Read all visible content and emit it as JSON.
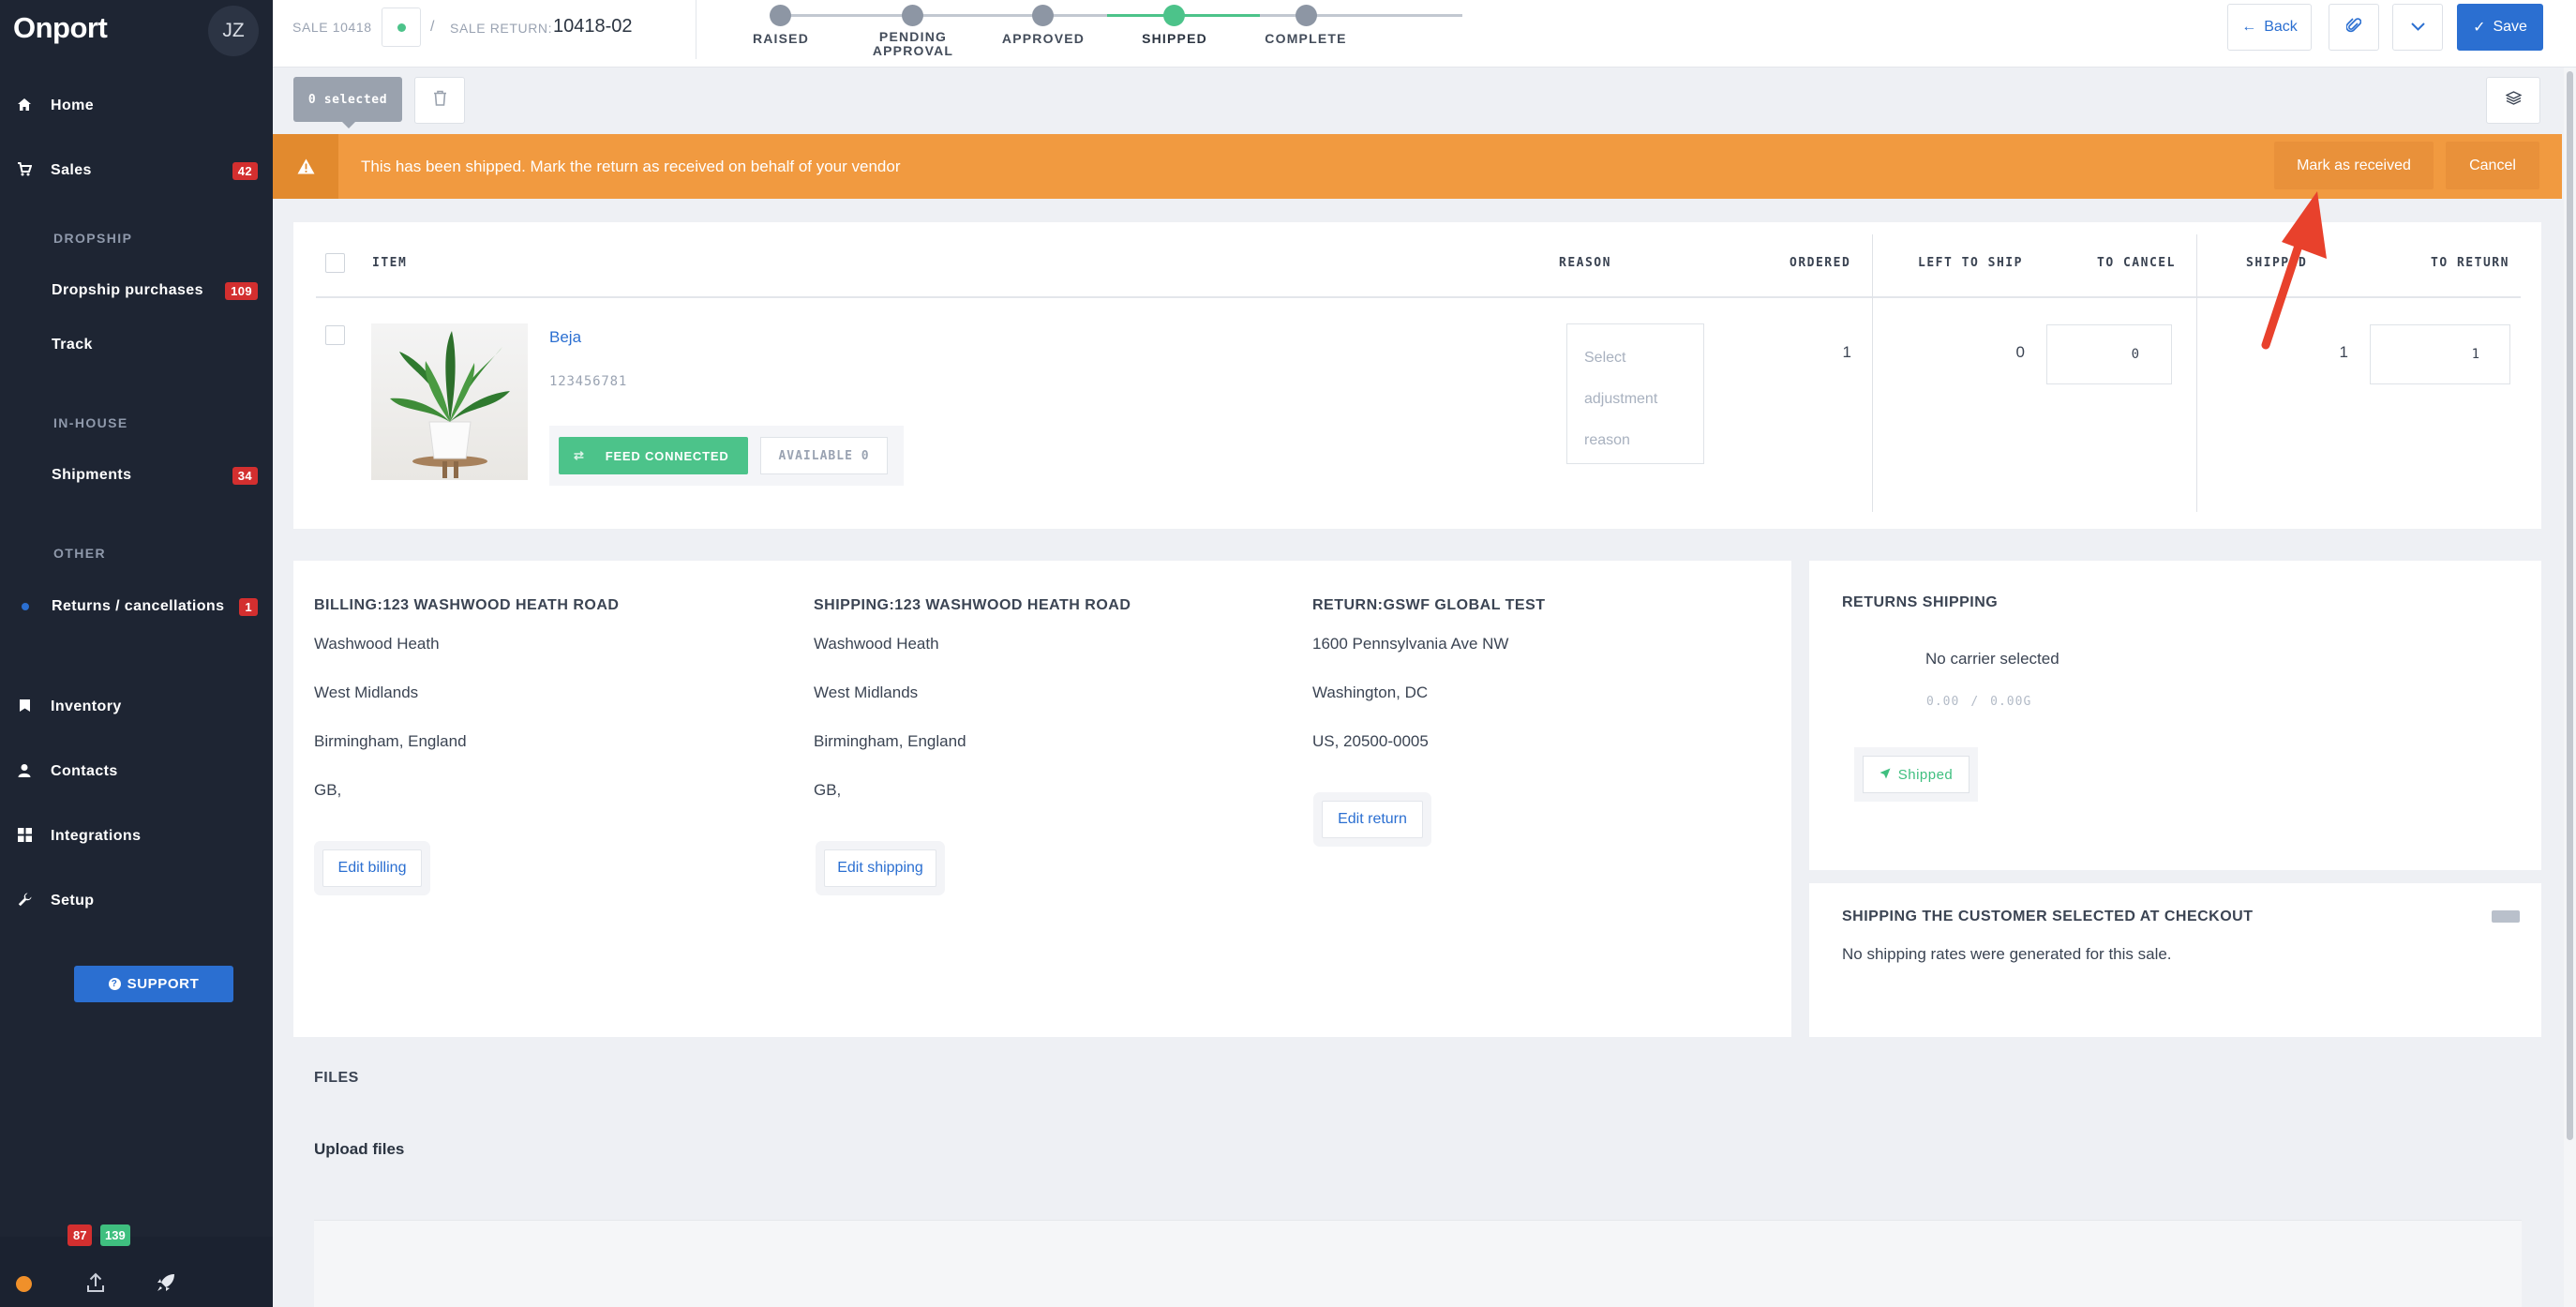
{
  "sidebar": {
    "logo": "Onport",
    "avatar_initials": "JZ",
    "items": {
      "home": "Home",
      "sales": "Sales",
      "sales_badge": "42",
      "dropship_heading": "DROPSHIP",
      "dropship_purchases": "Dropship purchases",
      "dropship_badge": "109",
      "track": "Track",
      "inhouse_heading": "IN-HOUSE",
      "shipments": "Shipments",
      "shipments_badge": "34",
      "other_heading": "OTHER",
      "returns": "Returns / cancellations",
      "returns_badge": "1",
      "inventory": "Inventory",
      "contacts": "Contacts",
      "integrations": "Integrations",
      "setup": "Setup"
    },
    "support_label": "SUPPORT",
    "footer": {
      "badge_red": "87",
      "badge_green": "139"
    }
  },
  "topbar": {
    "sale_label": "SALE 10418",
    "separator": "/",
    "sale_return_label": "SALE RETURN:",
    "sale_return_value": "10418-02",
    "steps": [
      "RAISED",
      "PENDING APPROVAL",
      "APPROVED",
      "SHIPPED",
      "COMPLETE"
    ],
    "active_step": "SHIPPED",
    "back_label": "Back",
    "save_label": "Save"
  },
  "selection": {
    "selected_label": "0 selected"
  },
  "banner": {
    "message": "This has been shipped. Mark the return as received on behalf of your vendor",
    "mark_received_label": "Mark as received",
    "cancel_label": "Cancel"
  },
  "items_table": {
    "headers": {
      "item": "ITEM",
      "reason": "REASON",
      "ordered": "ORDERED",
      "left_to_ship": "LEFT TO SHIP",
      "to_cancel": "TO CANCEL",
      "shipped": "SHIPPED",
      "to_return": "TO RETURN"
    },
    "row": {
      "name": "Beja",
      "sku": "123456781",
      "feed_label": "FEED CONNECTED",
      "available_label": "AVAILABLE 0",
      "reason_placeholder": [
        "Select",
        "adjustment",
        "reason"
      ],
      "ordered": "1",
      "left_to_ship": "0",
      "to_cancel": "0",
      "shipped": "1",
      "to_return": "1"
    }
  },
  "addresses": {
    "billing": {
      "title": "BILLING:123 WASHWOOD HEATH ROAD",
      "lines": [
        "Washwood Heath",
        "West Midlands",
        "Birmingham, England",
        "GB,"
      ],
      "edit_label": "Edit billing"
    },
    "shipping": {
      "title": "SHIPPING:123 WASHWOOD HEATH ROAD",
      "lines": [
        "Washwood Heath",
        "West Midlands",
        "Birmingham, England",
        "GB,"
      ],
      "edit_label": "Edit shipping"
    },
    "return": {
      "title": "RETURN:GSWF GLOBAL TEST",
      "lines": [
        "1600 Pennsylvania Ave NW",
        "Washington, DC",
        "US, 20500-0005"
      ],
      "edit_label": "Edit return"
    }
  },
  "returns_shipping": {
    "title": "RETURNS SHIPPING",
    "carrier": "No carrier selected",
    "cost_a": "0.00",
    "cost_sep": "/",
    "cost_b": "0.00G",
    "status_label": "Shipped"
  },
  "checkout_shipping": {
    "title": "SHIPPING THE CUSTOMER SELECTED AT CHECKOUT",
    "message": "No shipping rates were generated for this sale."
  },
  "files": {
    "title": "FILES",
    "upload_label": "Upload files"
  },
  "colors": {
    "sidebar_bg": "#1e2533",
    "accent_blue": "#2b6fd1",
    "banner_orange": "#f19a40",
    "success_green": "#4cc38a",
    "badge_red": "#d32f2f",
    "annotation_arrow": "#e8412c"
  }
}
